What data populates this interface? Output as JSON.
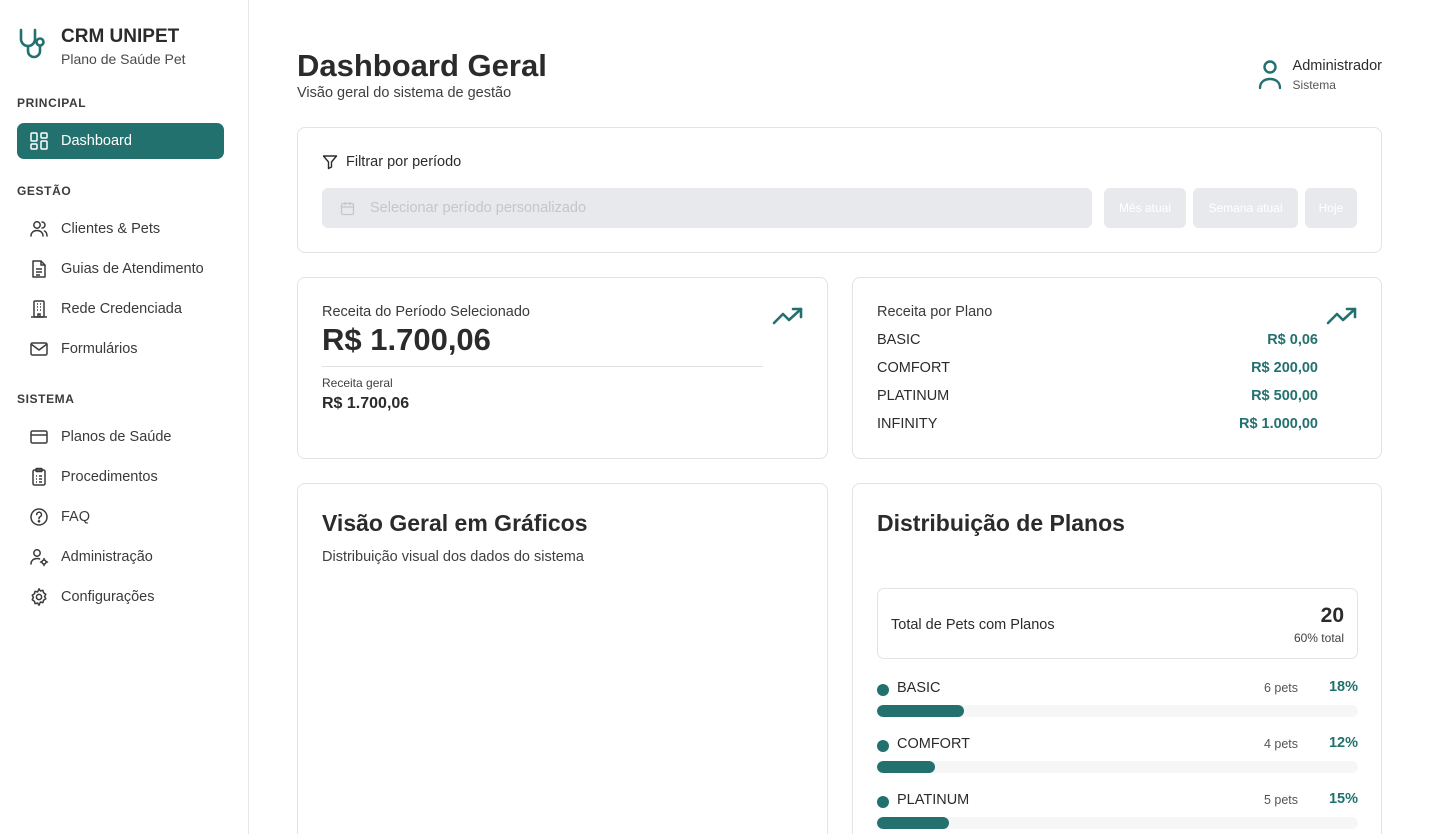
{
  "brand": {
    "title": "CRM UNIPET",
    "subtitle": "Plano de Saúde Pet",
    "icon": "stethoscope-icon"
  },
  "sidebar": {
    "sections": [
      {
        "label": "PRINCIPAL",
        "items": [
          {
            "label": "Dashboard",
            "icon": "dashboard-icon",
            "active": true
          }
        ]
      },
      {
        "label": "GESTÃO",
        "items": [
          {
            "label": "Clientes & Pets",
            "icon": "users-icon"
          },
          {
            "label": "Guias de Atendimento",
            "icon": "file-text-icon"
          },
          {
            "label": "Rede Credenciada",
            "icon": "building-icon"
          },
          {
            "label": "Formulários",
            "icon": "mail-icon"
          }
        ]
      },
      {
        "label": "SISTEMA",
        "items": [
          {
            "label": "Planos de Saúde",
            "icon": "credit-card-icon"
          },
          {
            "label": "Procedimentos",
            "icon": "clipboard-list-icon"
          },
          {
            "label": "FAQ",
            "icon": "help-circle-icon"
          },
          {
            "label": "Administração",
            "icon": "user-cog-icon"
          },
          {
            "label": "Configurações",
            "icon": "settings-icon"
          }
        ]
      }
    ]
  },
  "header": {
    "title": "Dashboard Geral",
    "subtitle": "Visão geral do sistema de gestão"
  },
  "user": {
    "name": "Administrador",
    "role": "Sistema",
    "icon": "user-icon"
  },
  "filter": {
    "title": "Filtrar por período",
    "placeholder": "Selecionar período personalizado",
    "buttons": [
      "Mês atual",
      "Semana atual",
      "Hoje"
    ]
  },
  "revenue": {
    "title": "Receita do Período Selecionado",
    "value": "R$ 1.700,06",
    "general_label": "Receita geral",
    "general_value": "R$ 1.700,06"
  },
  "revenue_by_plan": {
    "title": "Receita por Plano",
    "rows": [
      {
        "plan": "BASIC",
        "value": "R$ 0,06"
      },
      {
        "plan": "COMFORT",
        "value": "R$ 200,00"
      },
      {
        "plan": "PLATINUM",
        "value": "R$ 500,00"
      },
      {
        "plan": "INFINITY",
        "value": "R$ 1.000,00"
      }
    ]
  },
  "charts_overview": {
    "title": "Visão Geral em Gráficos",
    "subtitle": "Distribuição visual dos dados do sistema"
  },
  "distribution": {
    "title": "Distribuição de Planos",
    "total_label": "Total de Pets com Planos",
    "total_value": "20",
    "total_sub": "60% total",
    "items": [
      {
        "name": "BASIC",
        "count": "6 pets",
        "pct": "18%",
        "fill": 18
      },
      {
        "name": "COMFORT",
        "count": "4 pets",
        "pct": "12%",
        "fill": 12
      },
      {
        "name": "PLATINUM",
        "count": "5 pets",
        "pct": "15%",
        "fill": 15
      }
    ]
  },
  "colors": {
    "accent": "#23716f",
    "muted": "#e8e9ec"
  }
}
